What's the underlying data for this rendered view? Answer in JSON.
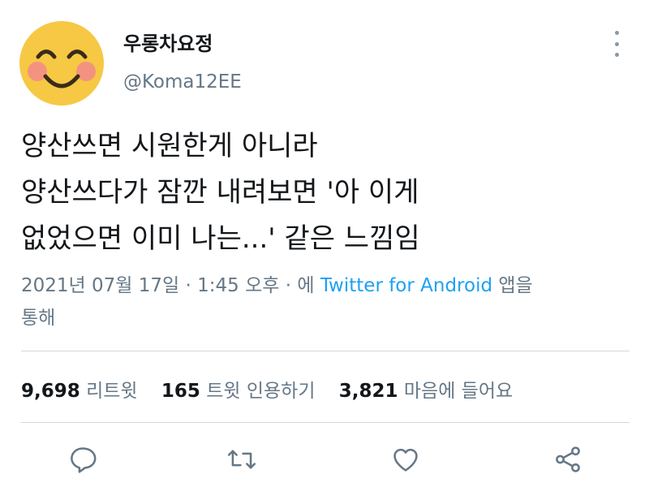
{
  "user": {
    "display_name": "우롱차요정",
    "handle": "@Koma12EE",
    "avatar_icon": "smiling-face-icon"
  },
  "tweet": {
    "lines": [
      "양산쓰면 시원한게 아니라",
      "양산쓰다가 잠깐 내려보면 '아 이게",
      "없었으면 이미 나는...' 같은 느낌임"
    ]
  },
  "meta": {
    "date": "2021년 07월 17일",
    "sep1": "·",
    "time": "1:45 오후",
    "sep2": "·",
    "prefix": "에",
    "source": "Twitter for Android",
    "suffix": "앱을",
    "suffix2": "통해"
  },
  "stats": {
    "retweets": "9,698",
    "retweets_label": "리트윗",
    "quotes": "165",
    "quotes_label": "트윗 인용하기",
    "likes": "3,821",
    "likes_label": "마음에 들어요"
  },
  "actions": [
    "reply-icon",
    "retweet-icon",
    "like-icon",
    "share-icon"
  ],
  "colors": {
    "link": "#1da1f2",
    "secondary_text": "#657786",
    "icon": "#657786"
  }
}
